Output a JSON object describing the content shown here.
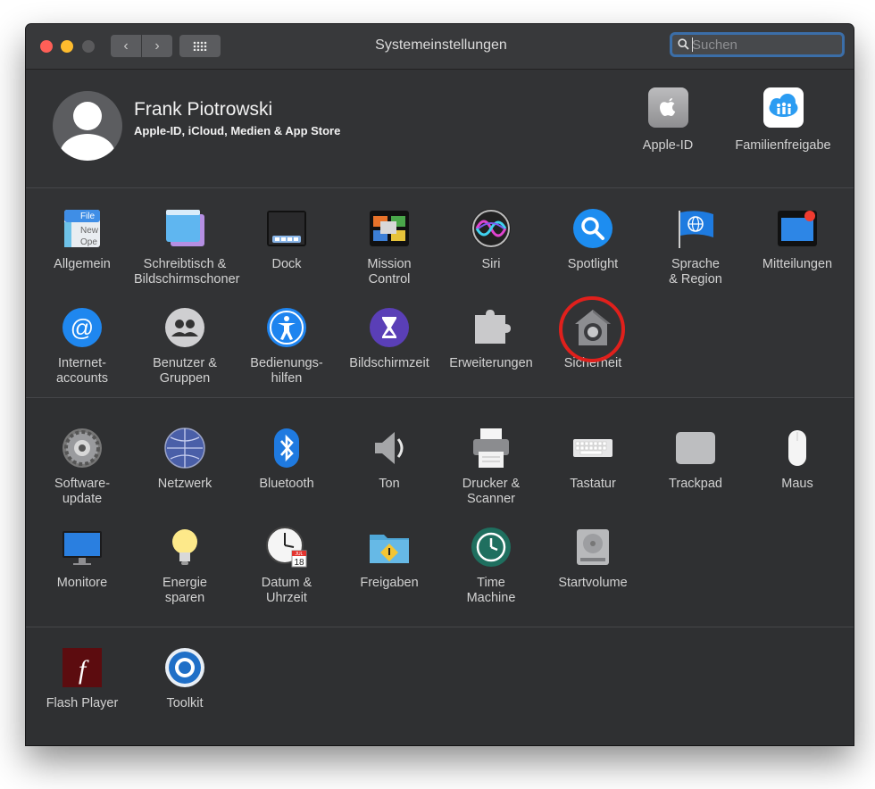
{
  "window": {
    "title": "Systemeinstellungen",
    "search_placeholder": "Suchen",
    "nav_back": "‹",
    "nav_forward": "›"
  },
  "profile": {
    "name": "Frank Piotrowski",
    "subtitle": "Apple-ID, iCloud, Medien & App Store",
    "top_items": [
      {
        "label": "Apple-ID",
        "icon": "apple-id-icon"
      },
      {
        "label": "Familienfreigabe",
        "icon": "family-sharing-icon"
      }
    ]
  },
  "sections": [
    {
      "items": [
        {
          "label": "Allgemein",
          "icon": "general-icon"
        },
        {
          "label": "Schreibtisch &\nBildschirmschoner",
          "icon": "desktop-screensaver-icon"
        },
        {
          "label": "Dock",
          "icon": "dock-icon"
        },
        {
          "label": "Mission\nControl",
          "icon": "mission-control-icon"
        },
        {
          "label": "Siri",
          "icon": "siri-icon"
        },
        {
          "label": "Spotlight",
          "icon": "spotlight-icon"
        },
        {
          "label": "Sprache\n& Region",
          "icon": "language-region-icon"
        },
        {
          "label": "Mitteilungen",
          "icon": "notifications-icon"
        },
        {
          "label": "Internet-\naccounts",
          "icon": "internet-accounts-icon"
        },
        {
          "label": "Benutzer &\nGruppen",
          "icon": "users-groups-icon"
        },
        {
          "label": "Bedienungs-\nhilfen",
          "icon": "accessibility-icon"
        },
        {
          "label": "Bildschirmzeit",
          "icon": "screen-time-icon"
        },
        {
          "label": "Erweiterungen",
          "icon": "extensions-icon"
        },
        {
          "label": "Sicherheit",
          "icon": "security-icon",
          "highlighted": true
        }
      ]
    },
    {
      "items": [
        {
          "label": "Software-\nupdate",
          "icon": "software-update-icon"
        },
        {
          "label": "Netzwerk",
          "icon": "network-icon"
        },
        {
          "label": "Bluetooth",
          "icon": "bluetooth-icon"
        },
        {
          "label": "Ton",
          "icon": "sound-icon"
        },
        {
          "label": "Drucker &\nScanner",
          "icon": "printer-scanner-icon"
        },
        {
          "label": "Tastatur",
          "icon": "keyboard-icon"
        },
        {
          "label": "Trackpad",
          "icon": "trackpad-icon"
        },
        {
          "label": "Maus",
          "icon": "mouse-icon"
        },
        {
          "label": "Monitore",
          "icon": "displays-icon"
        },
        {
          "label": "Energie\nsparen",
          "icon": "energy-saver-icon"
        },
        {
          "label": "Datum &\nUhrzeit",
          "icon": "date-time-icon"
        },
        {
          "label": "Freigaben",
          "icon": "sharing-icon"
        },
        {
          "label": "Time\nMachine",
          "icon": "time-machine-icon"
        },
        {
          "label": "Startvolume",
          "icon": "startup-disk-icon"
        }
      ]
    },
    {
      "items": [
        {
          "label": "Flash Player",
          "icon": "flash-player-icon"
        },
        {
          "label": "Toolkit",
          "icon": "toolkit-icon"
        }
      ]
    }
  ],
  "icon_texts": {
    "general": [
      "File",
      "New",
      "Ope"
    ],
    "date_month": "JUL",
    "date_day": "18",
    "flash": "f"
  },
  "colors": {
    "window_bg": "#323335",
    "highlight_circle": "#e0201c",
    "search_focus": "#3b6ea8"
  }
}
